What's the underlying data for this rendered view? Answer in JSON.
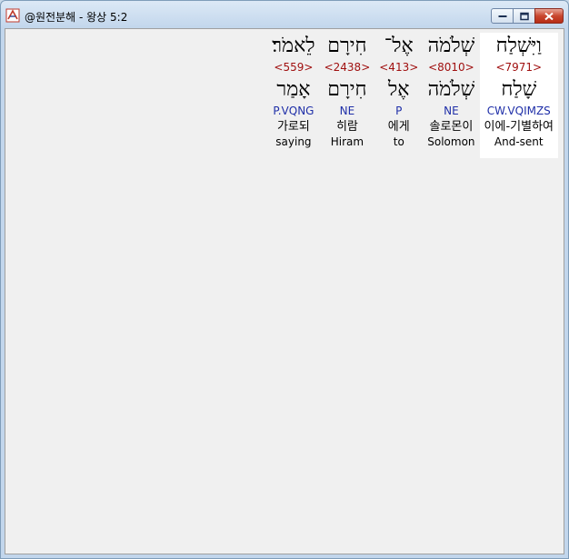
{
  "window": {
    "title": "@원전분해 - 왕상 5:2"
  },
  "words": [
    {
      "surface": "וַיִּשְׁלַח",
      "strong": "<7971>",
      "lemma": "שָׁלַח",
      "morph": "CW.VQIMZS",
      "korean": "이에-기별하여",
      "english": "And-sent",
      "selected": true
    },
    {
      "surface": "שְׁלֹמֹה",
      "strong": "<8010>",
      "lemma": "שְׁלֹמֹה",
      "morph": "NE",
      "korean": "솔로몬이",
      "english": "Solomon",
      "selected": false
    },
    {
      "surface": "אֶל־",
      "strong": "<413>",
      "lemma": "אֶל",
      "morph": "P",
      "korean": "에게",
      "english": "to",
      "selected": false
    },
    {
      "surface": "חִירָם",
      "strong": "<2438>",
      "lemma": "חִירָם",
      "morph": "NE",
      "korean": "히람",
      "english": "Hiram",
      "selected": false
    },
    {
      "surface": "לֵאמֹר׃",
      "strong": "<559>",
      "lemma": "אָמַר",
      "morph": "P.VQNG",
      "korean": "가로되",
      "english": "saying",
      "selected": false
    }
  ]
}
